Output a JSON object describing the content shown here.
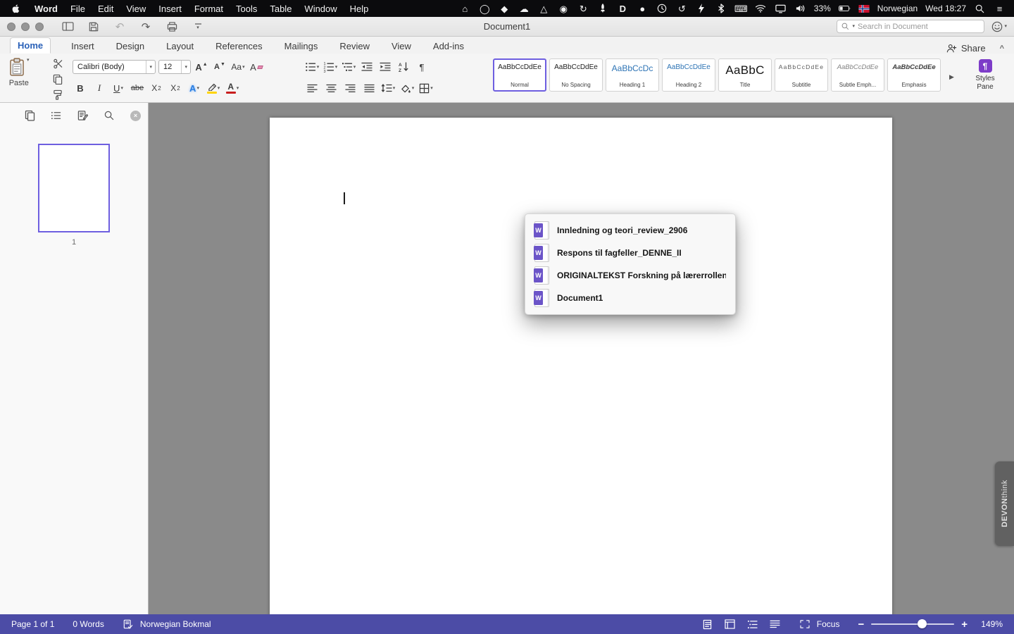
{
  "colors": {
    "accent": "#6e5fe0",
    "statusbar": "#4c4ca6",
    "headingblue": "#2e74b5",
    "tabblue": "#2a61b8",
    "wordicon": "#6b54c8",
    "stylespane": "#7d3cc8",
    "highlight": "#ffd400",
    "fontred": "#c81e1e"
  },
  "icons": {
    "dropdown": "▾",
    "arrow_up": "▲",
    "arrow_down": "▼",
    "sort_arrow": "↓",
    "pilcrow": "¶",
    "undo": "↶",
    "redo": "↷",
    "more": "▶",
    "close": "×",
    "caret_up": "^",
    "home": "⌂",
    "oval": "◯",
    "dropbox": "◆",
    "cloud": "☁",
    "warning": "△",
    "info": "◉",
    "sync": "↻",
    "d_app": "D",
    "paw": "●",
    "timemachine": "↺",
    "keyboard": "⌨",
    "lines": "≡",
    "word_letter": "W"
  },
  "menubar": {
    "items": [
      "Word",
      "File",
      "Edit",
      "View",
      "Insert",
      "Format",
      "Tools",
      "Table",
      "Window",
      "Help"
    ],
    "battery": "33%",
    "input_source": "Norwegian",
    "clock": "Wed 18:27"
  },
  "titlebar": {
    "title": "Document1",
    "search_placeholder": "Search in Document"
  },
  "tabs": {
    "items": [
      "Home",
      "Insert",
      "Design",
      "Layout",
      "References",
      "Mailings",
      "Review",
      "View",
      "Add-ins"
    ],
    "share": "Share"
  },
  "ribbon": {
    "paste": "Paste",
    "font_name": "Calibri (Body)",
    "font_size": "12",
    "grow": "A",
    "shrink": "A",
    "case": "Aa",
    "clear": "A",
    "bold": "B",
    "italic": "I",
    "underline": "U",
    "strike": "abe",
    "subscript": "X",
    "subscript_n": "2",
    "superscript": "X",
    "superscript_n": "2",
    "effects": "A",
    "fontcolor": "A",
    "sort_a": "A",
    "sort_z": "Z",
    "styles": [
      {
        "sample": "AaBbCcDdEe",
        "label": "Normal"
      },
      {
        "sample": "AaBbCcDdEe",
        "label": "No Spacing"
      },
      {
        "sample": "AaBbCcDc",
        "label": "Heading 1"
      },
      {
        "sample": "AaBbCcDdEe",
        "label": "Heading 2"
      },
      {
        "sample": "AaBbC",
        "label": "Title"
      },
      {
        "sample": "AaBbCcDdEe",
        "label": "Subtitle"
      },
      {
        "sample": "AaBbCcDdEe",
        "label": "Subtle Emph..."
      },
      {
        "sample": "AaBbCcDdEe",
        "label": "Emphasis"
      }
    ],
    "styles_pane_line1": "Styles",
    "styles_pane_line2": "Pane"
  },
  "sidebar": {
    "page_number": "1"
  },
  "switcher": {
    "items": [
      "Innledning og teori_review_2906",
      "Respons til fagfeller_DENNE_II",
      "ORIGINALTEKST Forskning på lærerrollen_i",
      "Document1"
    ]
  },
  "devonthink": {
    "bold": "DEVON",
    "rest": "think"
  },
  "statusbar": {
    "page": "Page 1 of 1",
    "words": "0 Words",
    "language": "Norwegian Bokmal",
    "focus": "Focus",
    "zoom": "149%"
  }
}
